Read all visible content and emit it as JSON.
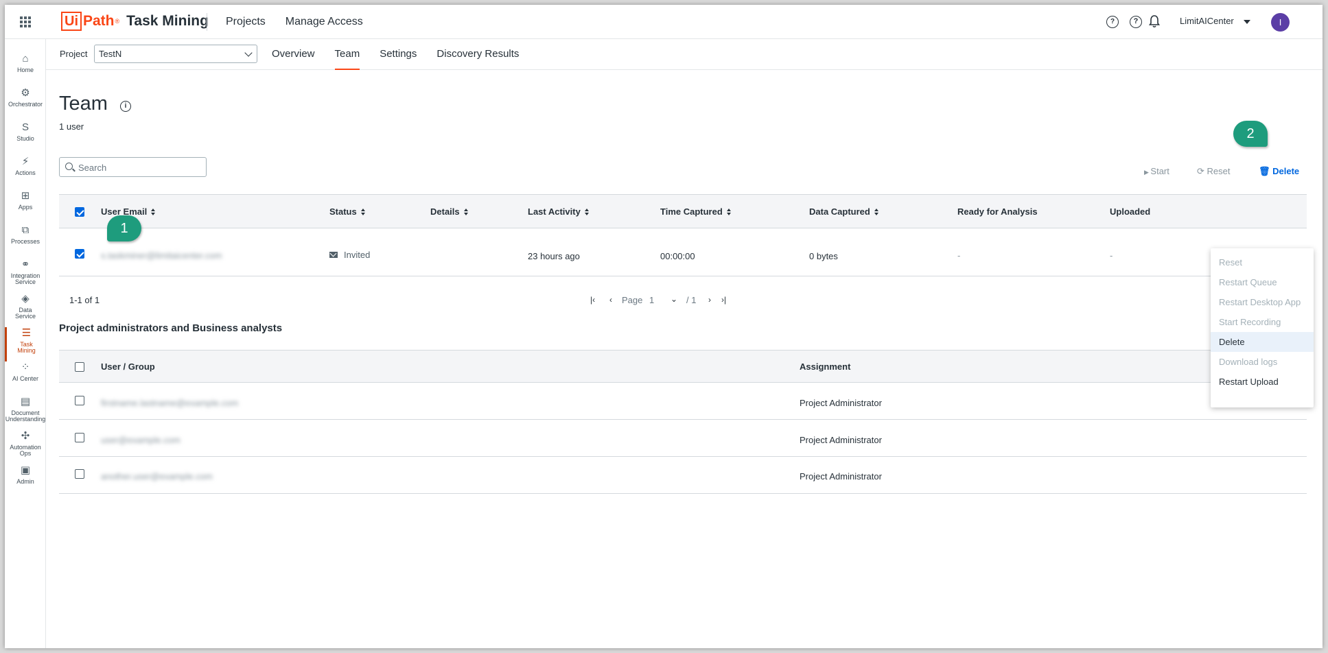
{
  "app": {
    "brand_box": "Ui",
    "brand_path": "Path",
    "brand_reg": "®",
    "product": "Task Mining"
  },
  "topnav": {
    "projects": "Projects",
    "manage_access": "Manage Access"
  },
  "header_right": {
    "help1": "?",
    "help2": "?",
    "tenant": "LimitAICenter",
    "avatar_initial": "I"
  },
  "sidebar": [
    {
      "label": "Home",
      "icon": "home-icon",
      "glyph": "⌂"
    },
    {
      "label": "Orchestrator",
      "icon": "orchestrator-icon",
      "glyph": "⚙"
    },
    {
      "label": "Studio",
      "icon": "studio-icon",
      "glyph": "S"
    },
    {
      "label": "Actions",
      "icon": "actions-icon",
      "glyph": "⚡"
    },
    {
      "label": "Apps",
      "icon": "apps-icon",
      "glyph": "⊞"
    },
    {
      "label": "Processes",
      "icon": "processes-icon",
      "glyph": "⧉"
    },
    {
      "label": "Integration\nService",
      "icon": "integration-icon",
      "glyph": "⚭"
    },
    {
      "label": "Data\nService",
      "icon": "data-service-icon",
      "glyph": "◈"
    },
    {
      "label": "Task\nMining",
      "icon": "task-mining-icon",
      "glyph": "☰"
    },
    {
      "label": "AI Center",
      "icon": "ai-center-icon",
      "glyph": "⁘"
    },
    {
      "label": "Document\nUnderstanding",
      "icon": "document-icon",
      "glyph": "▤"
    },
    {
      "label": "Automation\nOps",
      "icon": "automation-ops-icon",
      "glyph": "✣"
    },
    {
      "label": "Admin",
      "icon": "admin-icon",
      "glyph": "▣"
    }
  ],
  "subnav": {
    "project_label": "Project",
    "project_value": "TestN",
    "tabs": [
      "Overview",
      "Team",
      "Settings",
      "Discovery Results"
    ],
    "active_tab": "Team"
  },
  "page": {
    "title": "Team",
    "user_count": "1 user",
    "search_placeholder": "Search"
  },
  "actions": {
    "start": "Start",
    "reset": "Reset",
    "delete": "Delete"
  },
  "callouts": {
    "one": "1",
    "two": "2"
  },
  "team_table": {
    "columns": [
      "User Email",
      "Status",
      "Details",
      "Last Activity",
      "Time Captured",
      "Data Captured",
      "Ready for Analysis",
      "Uploaded"
    ],
    "rows": [
      {
        "email": "s.taskminer@limitaicenter.com",
        "status": "Invited",
        "details": "",
        "last_activity": "23 hours ago",
        "time_captured": "00:00:00",
        "data_captured": "0 bytes",
        "ready": "-",
        "uploaded": "-"
      }
    ]
  },
  "pager": {
    "range": "1-1 of 1",
    "page_label": "Page",
    "page_value": "1",
    "total": "/ 1"
  },
  "admins": {
    "section_title": "Project administrators and Business analysts",
    "columns": [
      "User / Group",
      "Assignment"
    ],
    "rows": [
      {
        "user": "firstname.lastname@example.com",
        "assignment": "Project Administrator"
      },
      {
        "user": "user@example.com",
        "assignment": "Project Administrator"
      },
      {
        "user": "another.user@example.com",
        "assignment": "Project Administrator"
      }
    ]
  },
  "context_menu": [
    {
      "label": "Reset",
      "state": "disabled"
    },
    {
      "label": "Restart Queue",
      "state": "disabled"
    },
    {
      "label": "Restart Desktop App",
      "state": "disabled"
    },
    {
      "label": "Start Recording",
      "state": "disabled"
    },
    {
      "label": "Delete",
      "state": "highlight"
    },
    {
      "label": "Download logs",
      "state": "disabled"
    },
    {
      "label": "Restart Upload",
      "state": "enabled"
    }
  ]
}
